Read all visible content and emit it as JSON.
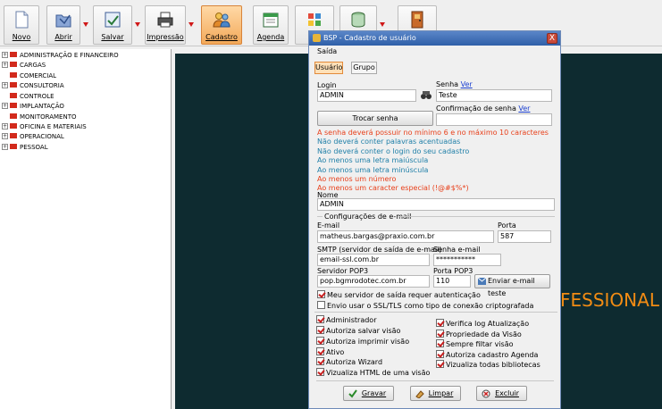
{
  "toolbar": {
    "buttons": [
      {
        "label": "Novo",
        "icon": "new-document-icon"
      },
      {
        "label": "Abrir",
        "icon": "open-folder-icon"
      },
      {
        "label": "Salvar",
        "icon": "save-icon"
      },
      {
        "label": "Impressão",
        "icon": "printer-icon"
      },
      {
        "label": "Cadastro",
        "icon": "users-icon"
      },
      {
        "label": "Agenda",
        "icon": "calendar-icon"
      },
      {
        "label": "",
        "icon": "tools-icon"
      },
      {
        "label": "",
        "icon": "database-icon"
      },
      {
        "label": "",
        "icon": "exit-door-icon"
      }
    ]
  },
  "tree": {
    "items": [
      {
        "label": "ADMINISTRAÇÃO E FINANCEIRO",
        "expander": "+"
      },
      {
        "label": "CARGAS",
        "expander": "+"
      },
      {
        "label": "COMERCIAL",
        "expander": ""
      },
      {
        "label": "CONSULTORIA",
        "expander": "+"
      },
      {
        "label": "CONTROLE",
        "expander": ""
      },
      {
        "label": "IMPLANTAÇÃO",
        "expander": "+"
      },
      {
        "label": "MONITORAMENTO",
        "expander": ""
      },
      {
        "label": "OFICINA E MATERIAIS",
        "expander": "+"
      },
      {
        "label": "OPERACIONAL",
        "expander": "+"
      },
      {
        "label": "PESSOAL",
        "expander": "+"
      }
    ]
  },
  "background": {
    "text": "FESSIONAL"
  },
  "dialog": {
    "title": "BSP - Cadastro de usuário",
    "close_label": "X",
    "menu": "Saída",
    "tabs": [
      "Usuário",
      "Grupo"
    ],
    "login": {
      "label": "Login",
      "value": "ADMIN"
    },
    "senha": {
      "label": "Senha",
      "link": "Ver",
      "value": "Teste"
    },
    "confirmacao": {
      "label": "Confirmação de senha",
      "link": "Ver",
      "value": ""
    },
    "trocar_senha": "Trocar senha",
    "rules": [
      {
        "text": "A senha deverá possuir no mínimo 6 e no máximo 10 caracteres",
        "color": "#e8411c"
      },
      {
        "text": "Não deverá conter palavras acentuadas",
        "color": "#1f7fa8"
      },
      {
        "text": "Não deverá conter o login do seu cadastro",
        "color": "#1f7fa8"
      },
      {
        "text": "Ao menos uma letra maiúscula",
        "color": "#1f7fa8"
      },
      {
        "text": "Ao menos uma letra minúscula",
        "color": "#1f7fa8"
      },
      {
        "text": "Ao menos um número",
        "color": "#e8411c"
      },
      {
        "text": "Ao menos um caracter especial (!@#$%*)",
        "color": "#e8411c"
      }
    ],
    "nome": {
      "label": "Nome",
      "value": "ADMIN"
    },
    "email_section": "Configurações de e-mail",
    "email": {
      "label": "E-mail",
      "value": "matheus.bargas@praxio.com.br"
    },
    "porta": {
      "label": "Porta",
      "value": "587"
    },
    "smtp": {
      "label": "SMTP (servidor de saída de e-mail)",
      "value": "email-ssl.com.br"
    },
    "senha_email": {
      "label": "Senha e-mail",
      "value": "***********"
    },
    "pop3": {
      "label": "Servidor POP3",
      "value": "pop.bgmrodotec.com.br"
    },
    "porta_pop3": {
      "label": "Porta POP3",
      "value": "110"
    },
    "enviar_teste": "Enviar e-mail teste",
    "options": [
      {
        "label": "Meu servidor de saída requer autenticação",
        "checked": true
      },
      {
        "label": "Envio usar o SSL/TLS como tipo de conexão criptografada",
        "checked": false
      }
    ],
    "permissions_left": [
      {
        "label": "Administrador",
        "checked": true
      },
      {
        "label": "Autoriza salvar visão",
        "checked": true
      },
      {
        "label": "Autoriza imprimir visão",
        "checked": true
      },
      {
        "label": "Ativo",
        "checked": true
      },
      {
        "label": "Autoriza Wizard",
        "checked": true
      },
      {
        "label": "Vizualiza HTML de uma visão",
        "checked": true
      }
    ],
    "permissions_right": [
      {
        "label": "Verifica log Atualização",
        "checked": true
      },
      {
        "label": "Propriedade da Visão",
        "checked": true
      },
      {
        "label": "Sempre filtar visão",
        "checked": true
      },
      {
        "label": "Autoriza cadastro Agenda",
        "checked": true
      },
      {
        "label": "Vizualiza todas bibliotecas",
        "checked": true
      }
    ],
    "buttons": {
      "gravar": "Gravar",
      "limpar": "Limpar",
      "excluir": "Excluir"
    }
  }
}
